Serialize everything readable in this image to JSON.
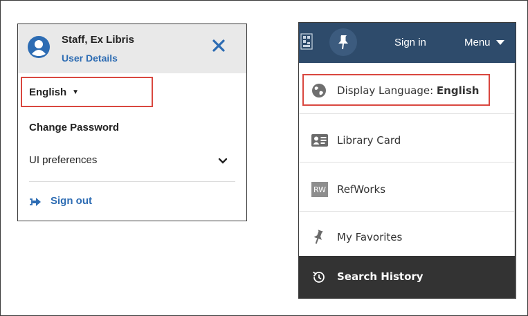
{
  "left_panel": {
    "user_name": "Staff, Ex Libris",
    "user_details": "User Details",
    "language": "English",
    "change_password": "Change Password",
    "ui_preferences": "UI preferences",
    "sign_out": "Sign out"
  },
  "right_panel": {
    "sign_in": "Sign in",
    "menu": "Menu",
    "items": [
      {
        "label_prefix": "Display Language: ",
        "label_value": "English",
        "icon": "globe-icon"
      },
      {
        "label": "Library Card",
        "icon": "id-card-icon"
      },
      {
        "label": "RefWorks",
        "icon": "refworks-icon",
        "icon_text": "RW"
      },
      {
        "label": "My Favorites",
        "icon": "pin-icon"
      },
      {
        "label": "Search History",
        "icon": "history-icon"
      }
    ]
  },
  "colors": {
    "link_blue": "#2d6cb3",
    "topbar": "#2e4b6b",
    "highlight_red": "#d9473f",
    "dark_item": "#333333"
  }
}
